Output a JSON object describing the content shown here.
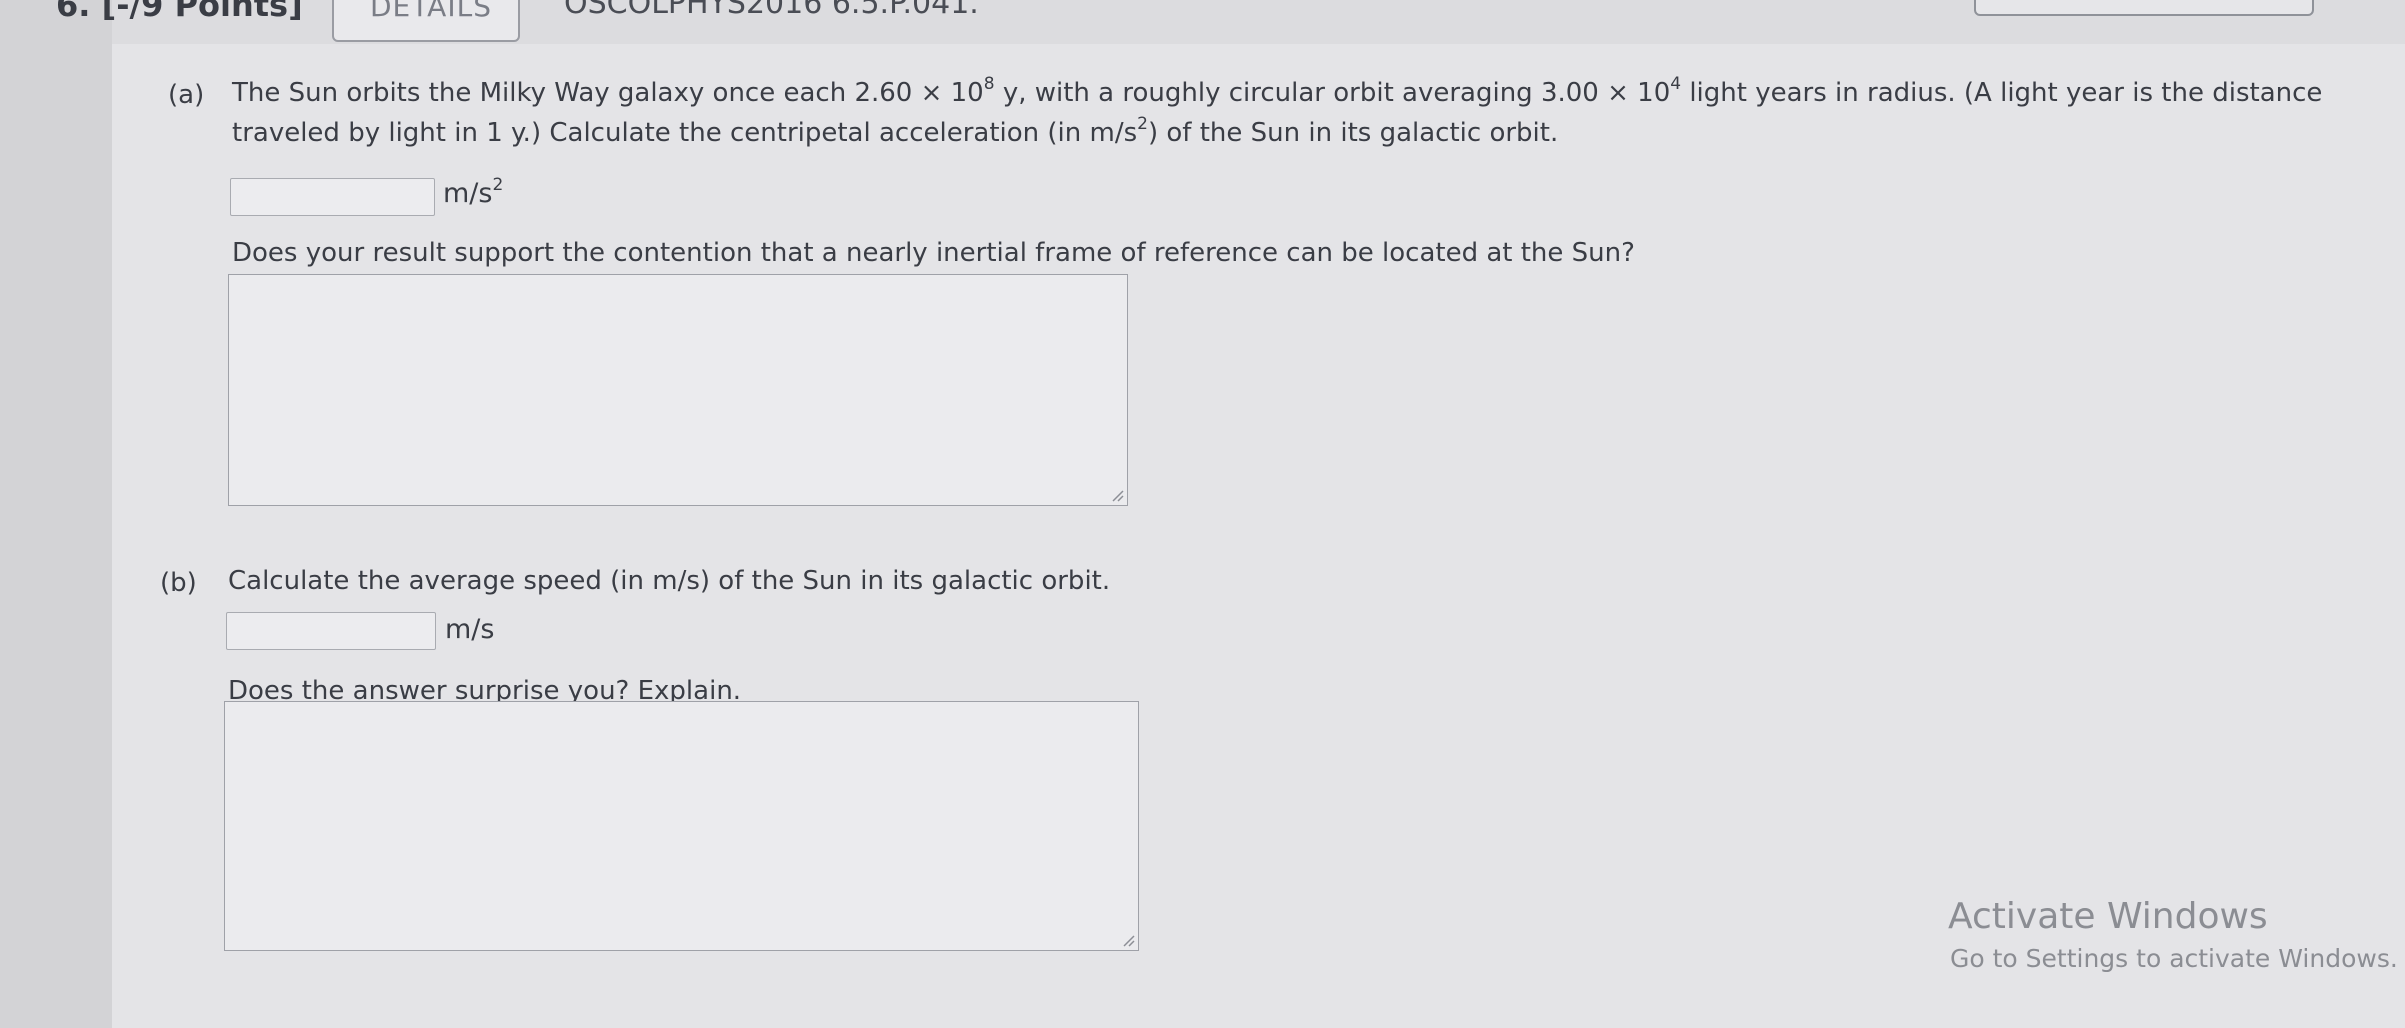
{
  "header": {
    "question_number": "6.  [-/9 Points]",
    "details_label": "DETAILS",
    "question_code": "OSCOLPHYS2016 6.5.P.041."
  },
  "part_a": {
    "label": "(a)",
    "text_line1_before_period": "The Sun orbits the Milky Way galaxy once each 2.60 × 10",
    "period_exponent": "8",
    "text_line1_middle": " y, with a roughly circular orbit averaging 3.00 × 10",
    "radius_exponent": "4",
    "text_line1_after": " light years in radius. (A light year is the distance",
    "text_line2_before": "traveled by light in 1 y.) Calculate the centripetal acceleration (in m/s",
    "text_line2_exponent": "2",
    "text_line2_after": ") of the Sun in its galactic orbit.",
    "answer_value": "",
    "unit_base": "m/s",
    "unit_exponent": "2",
    "followup_question": "Does your result support the contention that a nearly inertial frame of reference can be located at the Sun?",
    "followup_answer": ""
  },
  "part_b": {
    "label": "(b)",
    "text": "Calculate the average speed (in m/s) of the Sun in its galactic orbit.",
    "answer_value": "",
    "unit": "m/s",
    "followup_question": "Does the answer surprise you? Explain.",
    "followup_answer": ""
  },
  "watermark": {
    "title": "Activate Windows",
    "subtitle": "Go to Settings to activate Windows."
  },
  "colors": {
    "page_background": "#e4e4e7",
    "text": "#3a3d45",
    "border": "#a9abb1",
    "watermark": "#8b8d93"
  }
}
